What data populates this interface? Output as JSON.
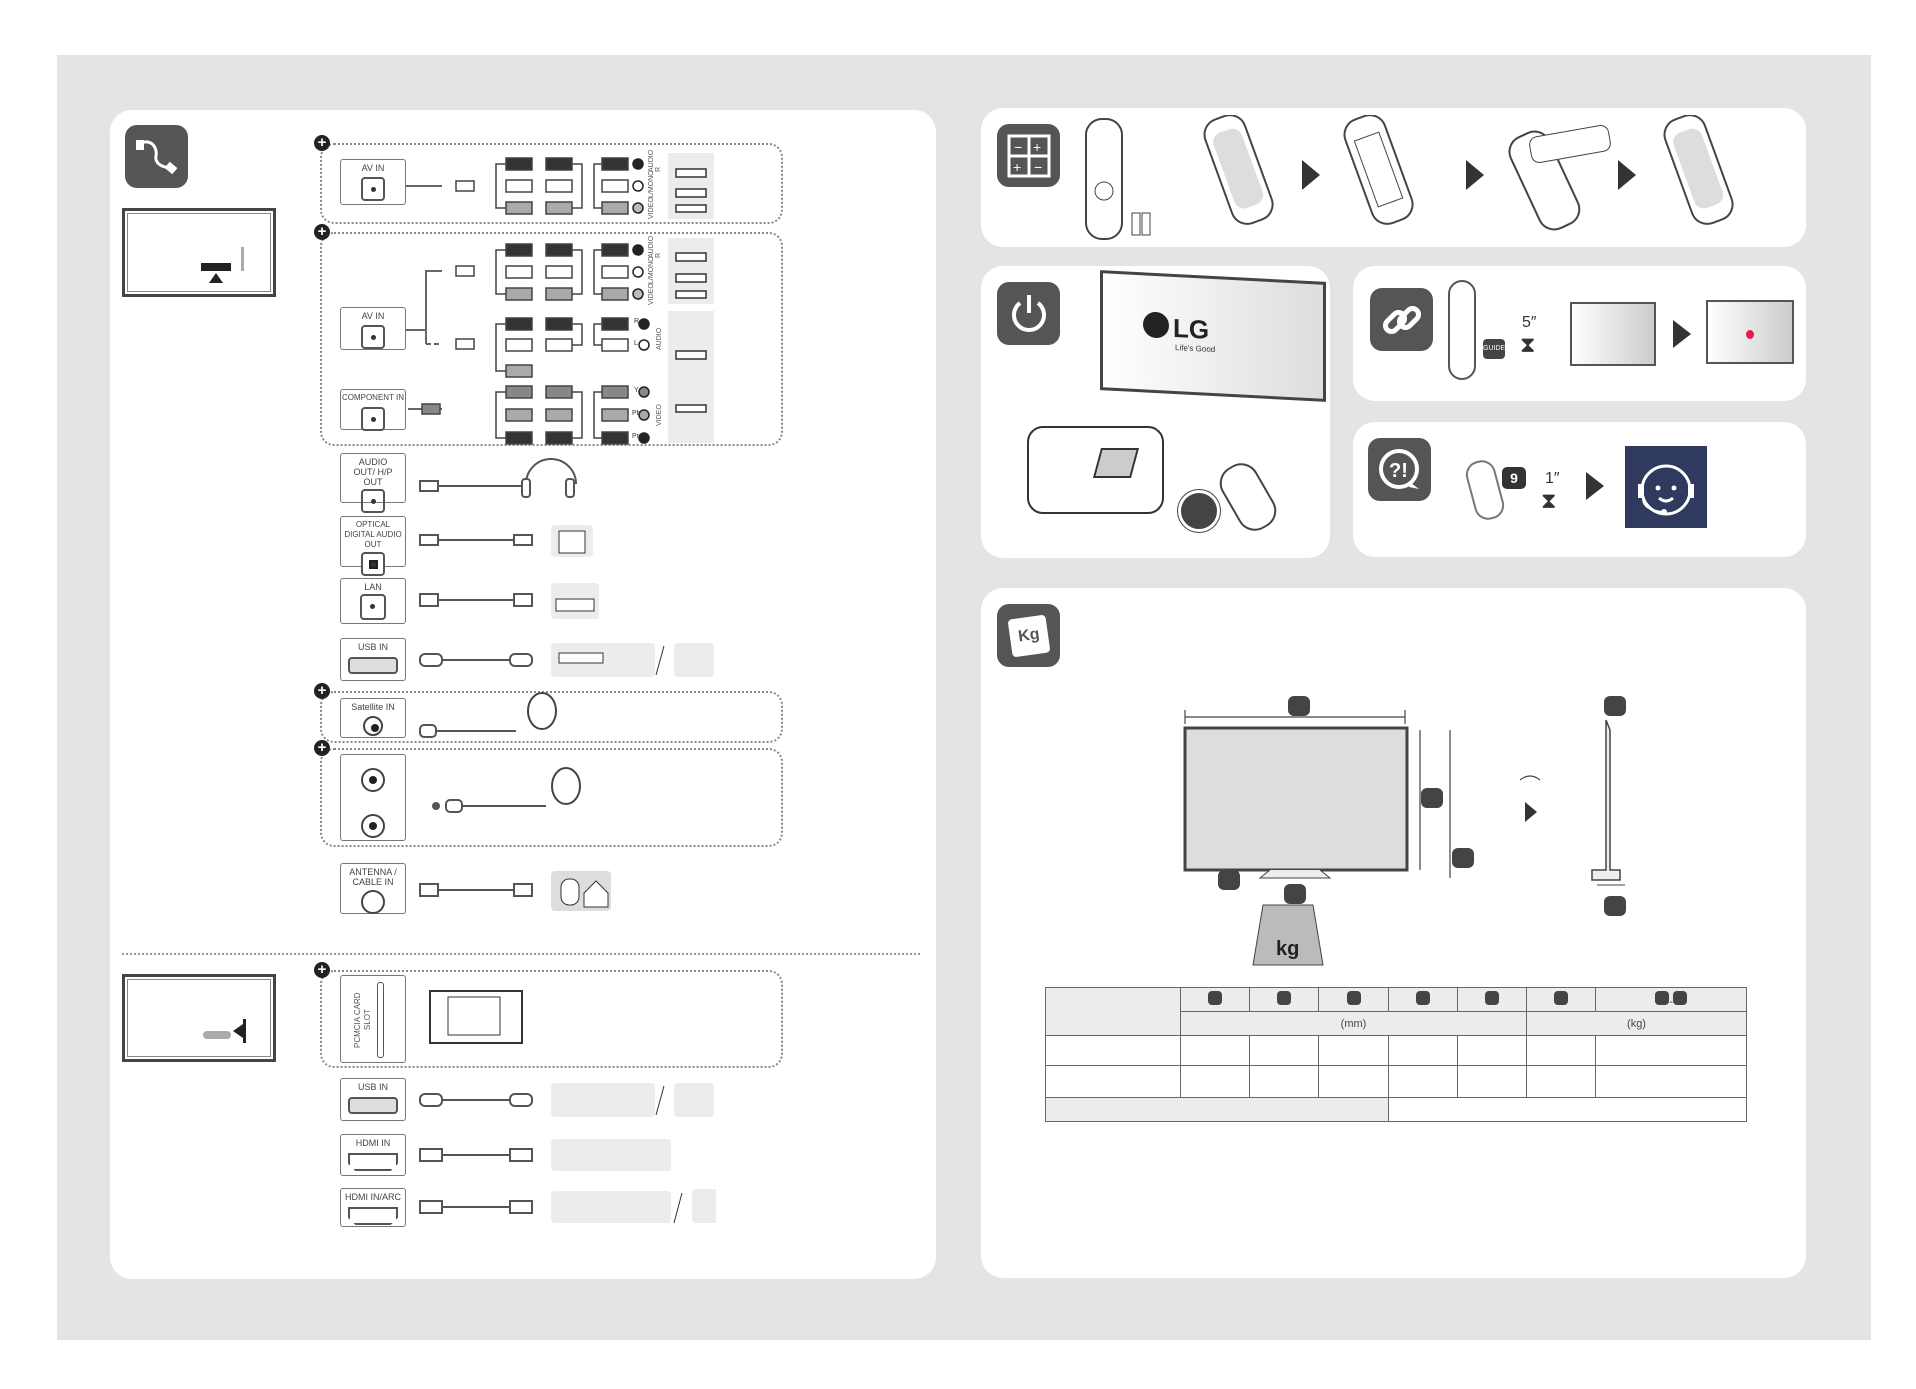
{
  "connections": {
    "ports": {
      "av_in": "AV IN",
      "av_in_2": "AV IN",
      "component_in": "COMPONENT IN",
      "audio_out": "AUDIO OUT/ H/P OUT",
      "optical": "OPTICAL DIGITAL AUDIO OUT",
      "lan": "LAN",
      "usb_in": "USB IN",
      "satellite_in": "Satellite IN",
      "antenna": "ANTENNA / CABLE IN",
      "pcmcia": "PCMCIA CARD SLOT",
      "usb_in_2": "USB IN",
      "hdmi_in": "HDMI IN",
      "hdmi_arc": "HDMI IN/ARC"
    },
    "jack_labels": {
      "audio_r": "AUDIO R",
      "l_mono": "L/MONO",
      "video": "VIDEO",
      "r": "R",
      "l": "L",
      "audio": "AUDIO",
      "y": "Y",
      "pb": "Pb",
      "pr": "Pr",
      "video2": "VIDEO"
    },
    "plus_symbol": "+"
  },
  "remote": {
    "magic_link_hold": "5″",
    "guide_button": "GUIDE",
    "help_hold": "1″",
    "help_button": "9"
  },
  "tv": {
    "logo": "LG",
    "slogan": "Life's Good"
  },
  "dimensions": {
    "icon_text": "Kg",
    "scale_text": "kg",
    "unit_mm": "(mm)",
    "unit_kg": "(kg)",
    "dash": "-"
  },
  "colors": {
    "icon_bg": "#555555",
    "sheet_bg": "#e4e4e4",
    "support_bg": "#2f3a5e",
    "pointer_red": "#e8194f"
  }
}
